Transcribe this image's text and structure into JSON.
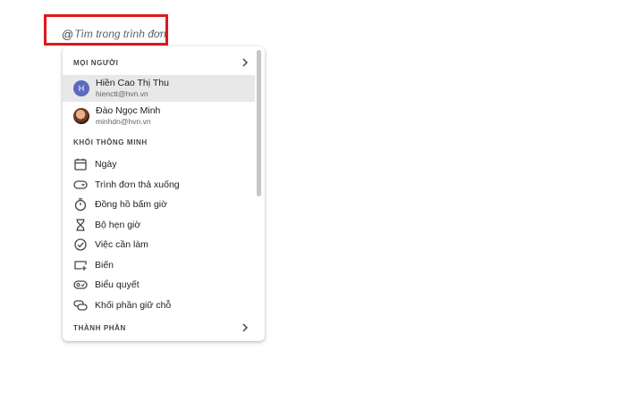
{
  "search": {
    "prefix": "@",
    "placeholder": "Tìm trong trình đơn",
    "highlight_color": "#e0161d"
  },
  "sections": {
    "people": {
      "title": "MỌI NGƯỜI",
      "chevron": "chevron-right-icon"
    },
    "smart_chips": {
      "title": "KHỐI THÔNG MINH"
    },
    "components": {
      "title": "THÀNH PHẦN",
      "chevron": "chevron-right-icon"
    }
  },
  "people": [
    {
      "name": "Hiền Cao Thị Thu",
      "email": "hienctt@hvn.vn",
      "initial": "H",
      "avatar_color": "#5c6bc0",
      "selected": true
    },
    {
      "name": "Đào Ngọc Minh",
      "email": "minhdn@hvn.vn",
      "avatar": "photo-avatar",
      "selected": false
    }
  ],
  "smart_chips": [
    {
      "label": "Ngày",
      "icon": "calendar-icon"
    },
    {
      "label": "Trình đơn thả xuống",
      "icon": "dropdown-chip-icon"
    },
    {
      "label": "Đồng hồ bấm giờ",
      "icon": "stopwatch-icon"
    },
    {
      "label": "Bộ hẹn giờ",
      "icon": "hourglass-icon"
    },
    {
      "label": "Việc cần làm",
      "icon": "check-circle-icon"
    },
    {
      "label": "Biến",
      "icon": "variable-icon"
    },
    {
      "label": "Biểu quyết",
      "icon": "vote-icon"
    },
    {
      "label": "Khối phần giữ chỗ",
      "icon": "placeholder-chip-icon"
    }
  ]
}
